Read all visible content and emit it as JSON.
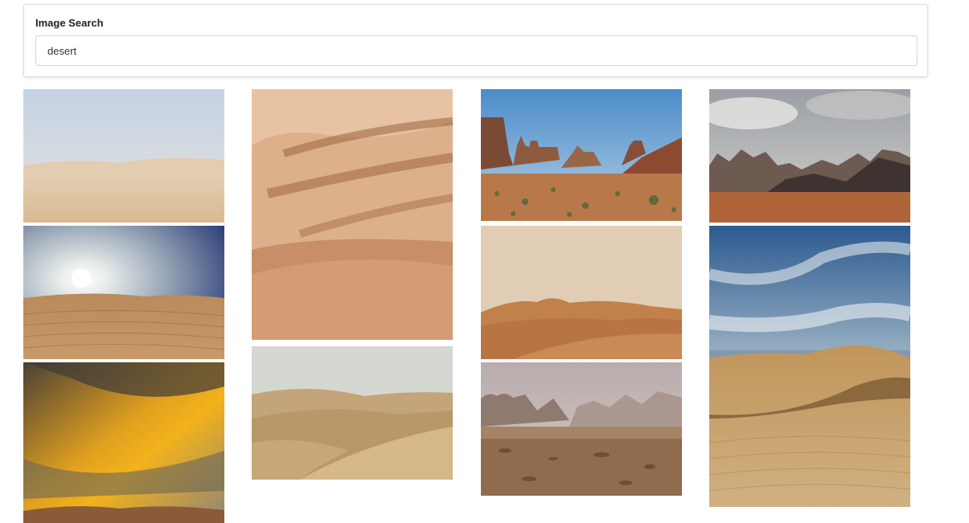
{
  "search": {
    "label": "Image Search",
    "value": "desert"
  },
  "results": [
    {
      "alt": "desert"
    },
    {
      "alt": "desert"
    },
    {
      "alt": "desert"
    },
    {
      "alt": "desert"
    },
    {
      "alt": "desert"
    },
    {
      "alt": "desert"
    },
    {
      "alt": "desert"
    },
    {
      "alt": "desert"
    },
    {
      "alt": "desert"
    },
    {
      "alt": "desert"
    },
    {
      "alt": "desert"
    }
  ]
}
